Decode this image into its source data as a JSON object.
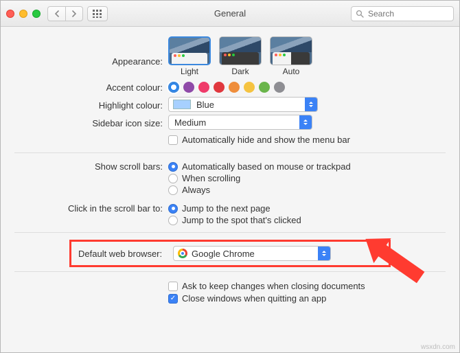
{
  "window": {
    "title": "General"
  },
  "search": {
    "placeholder": "Search"
  },
  "labels": {
    "appearance": "Appearance:",
    "accent": "Accent colour:",
    "highlight": "Highlight colour:",
    "sidebar": "Sidebar icon size:",
    "scrollbars": "Show scroll bars:",
    "scrollclick": "Click in the scroll bar to:",
    "browser": "Default web browser:"
  },
  "appearance": {
    "options": [
      "Light",
      "Dark",
      "Auto"
    ],
    "selected": "Light"
  },
  "accent_colours": [
    "#0a7aff",
    "#8f4aa8",
    "#ef3b6a",
    "#e0383e",
    "#ef8e3c",
    "#f5c341",
    "#6ab54b",
    "#8e8e93"
  ],
  "highlight": {
    "value": "Blue",
    "swatch": "#a7d0ff"
  },
  "sidebar_size": {
    "value": "Medium"
  },
  "menubar_autohide": {
    "checked": false,
    "label": "Automatically hide and show the menu bar"
  },
  "scroll_options": {
    "auto": "Automatically based on mouse or trackpad",
    "scrolling": "When scrolling",
    "always": "Always",
    "selected": "auto"
  },
  "scrollclick_options": {
    "next": "Jump to the next page",
    "spot": "Jump to the spot that's clicked",
    "selected": "next"
  },
  "browser": {
    "value": "Google Chrome"
  },
  "bottom": {
    "ask_changes": {
      "checked": false,
      "label": "Ask to keep changes when closing documents"
    },
    "close_windows": {
      "checked": true,
      "label": "Close windows when quitting an app"
    }
  },
  "watermark": "wsxdn.com"
}
